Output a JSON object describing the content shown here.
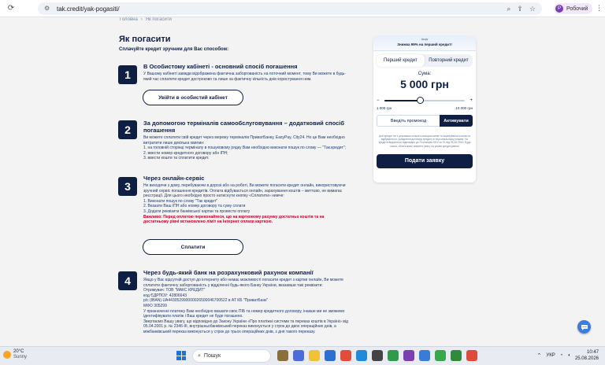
{
  "browser": {
    "url": "tak.credit/yak-pogasiti/",
    "profile_initial": "Р",
    "profile_name": "Робочий"
  },
  "page": {
    "breadcrumb": [
      "Головна",
      "Як погасити"
    ],
    "title": "Як погасити",
    "subtitle": "Сплачуйте кредит зручним для Вас способом:"
  },
  "steps": [
    {
      "number": "1",
      "title": "В Особистому кабінеті - основний спосіб погашення",
      "lines": [
        "У Вашому кабінеті завжди відображена фактична заборгованість на поточний момент, тому Ви можете в будь-",
        "який час сплатити кредит достроково та лише за фактичну кількість днів користування ним."
      ],
      "button": "Увійти в особистий кабінет"
    },
    {
      "number": "2",
      "title_lines": [
        "За допомогою терміналів самообслуговування – додатковий спосіб",
        "погашення"
      ],
      "lines": [
        "Ви можете сплатити свій кредит через мережу терміналів ПриватБанку, EasyPay, City24. Но це Вам необхідно",
        "витратити лише декілька хвилин:",
        "1. на головній сторінці терміналу в пошуковому рядку Вам необхідно виконати пошук по слову — \"Так.кредит\";",
        "2. ввести номер кредитного договору або ІПН;",
        "3. ввести кошти та сплатити кредит."
      ]
    },
    {
      "number": "3",
      "title": "Через онлайн-сервіс",
      "lines": [
        "Не виходячи з дому, перебуваючи в дорозі або на роботі, Ви можете погасити кредит онлайн, використовуючи",
        "зручний сервіс погашення кредитів. Оплата відбувається онлайн, зарахування коштів – миттєво, не вимагає",
        "реєстрації. Для цього необхідно просто натиснути кнопку «Сплатити» нижче:",
        "1. Виконати пошук по слову \"Так кредит\"",
        "2. Вказати Ваш ІПН або номер договору та суму сплати",
        "3. Додати реквізити банківської картки та провести оплату"
      ],
      "warning": [
        "Важливо: Перед оплатою переконайтеся, що на картковому рахунку достатньо коштів та на",
        "достатньому рівні встановлено ліміт на Інтернет оплати карткою."
      ],
      "button": "Сплатити"
    },
    {
      "number": "4",
      "title": "Через будь-який банк на розрахунковий рахунок компанії",
      "lines": [
        "Якщо у Вас відсутній доступ до інтернету або немає можливості погасити кредит з картки онлайн, Ви можете",
        "сплатити фактичну заборгованість у відділенні будь-якого Банку України, вказавши такі реквізити:",
        "Отримувач: ТОВ \"МАКС КРЕДИТ\"",
        "код ЄДРПОУ: 42806643",
        "р/с (IBAN) UA443052990000026500046700522 в АТ КБ \"ПриватБанк\"",
        "МФО 305299",
        "У призначенні платежу Вам необхідно вказати своє ПІБ та номер кредитного договору, інакше ми не зможемо",
        "ідентифікувати платіж і Ваш кредит не буде погашено.",
        "Звертаємо Вашу увагу, що відповідно до Закону України «Про платіжні системи та переказ коштів в Україні» від",
        "05.04.2001 р. № 2346-III, внутрішньобанківський переказ виконується у строк до двох операційних днів, а",
        "міжбанківський переказ виконується у строк до трьох операційних днів, з дня такого переказу."
      ]
    }
  ],
  "widget": {
    "banner_small": "Акція",
    "banner_big": "Знижка 99% на перший кредит!",
    "tabs": [
      "Перший кредит",
      "Повторний кредит"
    ],
    "active_tab": 0,
    "sum_label": "Сума:",
    "sum_value": "5 000 грн",
    "slider_min_label": "1 000 грн",
    "slider_max_label": "10 000 грн",
    "slider_fraction": 0.444,
    "minus": "−",
    "plus": "+",
    "promo_placeholder": "Введіть промокод",
    "promo_button": "Активувати",
    "disclaimer": "Цей кредит не є рекламою,кількість використання та зарахування коштів не відбувається, укладання договору кредиту в персональному режимі. Усі кредити видаються відповідно до Постанови НБУ № 91 від 28.06.2019. Будь ласка, обов'язково зверніть увагу на умови кредитування",
    "submit": "Подати заявку"
  },
  "taskbar": {
    "temp": "20°C",
    "condition": "Sunny",
    "search_placeholder": "Пошук",
    "lang": "УКР",
    "time": "10:47",
    "date": "25.08.2026"
  },
  "colors": {
    "brand_dark": "#0f1f44",
    "warning": "#c0002a",
    "chat": "#3d7be0"
  }
}
